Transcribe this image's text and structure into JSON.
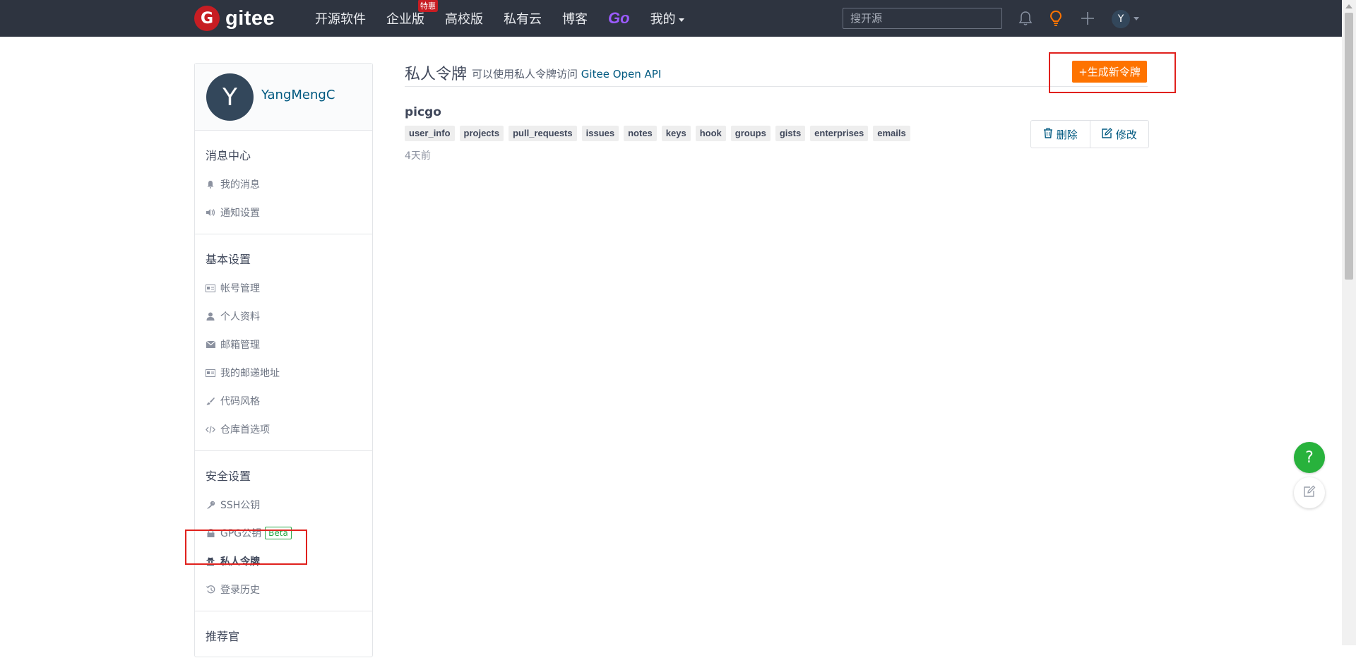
{
  "brand": {
    "logo_letter": "G",
    "name": "gitee"
  },
  "nav": {
    "items": [
      "开源软件",
      "企业版",
      "高校版",
      "私有云",
      "博客",
      "Go",
      "我的"
    ],
    "badge": "特惠"
  },
  "search": {
    "placeholder": "搜开源"
  },
  "user": {
    "avatar_letter": "Y",
    "name": "YangMengC"
  },
  "sidebar": {
    "sections": [
      {
        "title": "消息中心",
        "items": [
          {
            "label": "我的消息",
            "icon": "bell-icon"
          },
          {
            "label": "通知设置",
            "icon": "volume-icon"
          }
        ]
      },
      {
        "title": "基本设置",
        "items": [
          {
            "label": "帐号管理",
            "icon": "id-card-icon"
          },
          {
            "label": "个人资料",
            "icon": "user-icon"
          },
          {
            "label": "邮箱管理",
            "icon": "envelope-icon"
          },
          {
            "label": "我的邮递地址",
            "icon": "address-card-icon"
          },
          {
            "label": "代码风格",
            "icon": "brush-icon"
          },
          {
            "label": "仓库首选项",
            "icon": "code-icon"
          }
        ]
      },
      {
        "title": "安全设置",
        "items": [
          {
            "label": "SSH公钥",
            "icon": "key-icon"
          },
          {
            "label": "GPG公钥",
            "icon": "lock-icon",
            "badge": "Beta"
          },
          {
            "label": "私人令牌",
            "icon": "user-secret-icon",
            "active": true
          },
          {
            "label": "登录历史",
            "icon": "history-icon"
          }
        ]
      },
      {
        "title": "推荐官",
        "items": []
      }
    ]
  },
  "main": {
    "title": "私人令牌",
    "subtitle_prefix": "可以使用私人令牌访问",
    "subtitle_link": "Gitee Open API",
    "generate_button": "+生成新令牌"
  },
  "token": {
    "name": "picgo",
    "scopes": [
      "user_info",
      "projects",
      "pull_requests",
      "issues",
      "notes",
      "keys",
      "hook",
      "groups",
      "gists",
      "enterprises",
      "emails"
    ],
    "time": "4天前",
    "delete_label": "删除",
    "edit_label": "修改"
  },
  "floating": {
    "help": "?"
  },
  "colors": {
    "topbar": "#2e3440",
    "accent": "#fe7300",
    "brand": "#c71d23",
    "link": "#005980",
    "help": "#28b23c",
    "highlight_box": "#e0211d"
  }
}
